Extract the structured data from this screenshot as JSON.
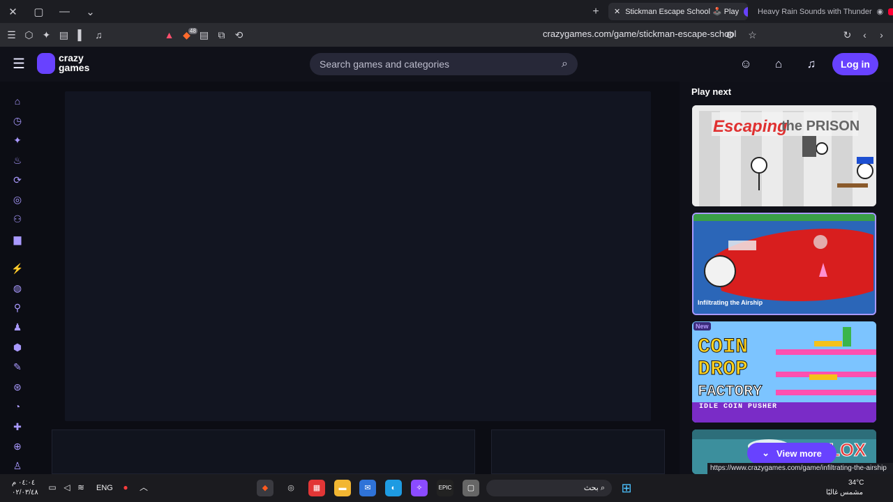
{
  "browser": {
    "tabs": [
      {
        "title": "Stickman Escape School 🕹️ Play"
      },
      {
        "title": "Heavy Rain Sounds with Thunder"
      }
    ],
    "url": "crazygames.com/game/stickman-escape-school",
    "toolbar_badge": "48",
    "icons": [
      "close-icon",
      "restore-icon",
      "minimize-icon",
      "chevron-down-icon"
    ]
  },
  "site": {
    "brand_line1": "crazy",
    "brand_line2": "games",
    "search_placeholder": "Search games and categories",
    "login": "Log in",
    "colors": {
      "accent": "#6842ff",
      "background": "#0c0d14",
      "header": "#101119"
    }
  },
  "sidebar": {
    "icons": [
      "home-icon",
      "clock-icon",
      "sparkle-icon",
      "flame-icon",
      "refresh-icon",
      "twitch-icon",
      "users-icon",
      "leaderboard-icon",
      "bolt-icon",
      "compass-icon",
      "joystick-icon",
      "person-icon",
      "cube-icon",
      "paint-icon",
      "steering-icon",
      "pacman-icon",
      "puzzle-icon",
      "target-icon",
      "game-icon"
    ]
  },
  "play_next": {
    "title": "Play next",
    "games": [
      {
        "title": "Escaping the Prison",
        "label": ""
      },
      {
        "title": "Infiltrating the Airship",
        "label": "Infiltrating the Airship"
      },
      {
        "title": "Coin Drop Factory",
        "label": "New",
        "subtitle": "IDLE COIN PUSHER"
      },
      {
        "title": "Stickman Roblox",
        "label": ""
      }
    ],
    "view_more": "View more"
  },
  "status_link": "https://www.crazygames.com/game/infiltrating-the-airship",
  "taskbar": {
    "time": "٠٤:٠٤ م",
    "date": "٠٢/٠٣/٤٨",
    "lang": "ENG",
    "search_label": "بحث",
    "weather_temp": "34°C",
    "weather_desc": "مشمس غالبًا"
  }
}
